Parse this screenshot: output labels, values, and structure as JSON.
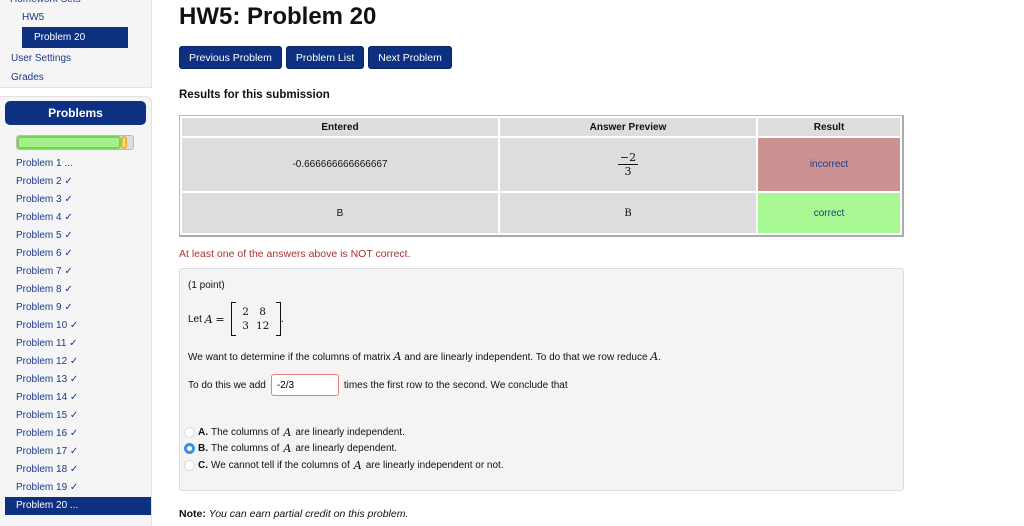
{
  "sidebar": {
    "truncated_top": "Homework Sets",
    "hw_link": "HW5",
    "current_problem": "Problem 20",
    "user_settings": "User Settings",
    "grades": "Grades"
  },
  "problems_panel": {
    "title": "Problems",
    "progress": {
      "correct_fraction": 0.9,
      "partial_fraction": 0.05,
      "green": "#a5f08a",
      "yellow": "#ffe94a"
    },
    "items": [
      {
        "label": "Problem 1 ...",
        "active": false
      },
      {
        "label": "Problem 2 ✓",
        "active": false
      },
      {
        "label": "Problem 3 ✓",
        "active": false
      },
      {
        "label": "Problem 4 ✓",
        "active": false
      },
      {
        "label": "Problem 5 ✓",
        "active": false
      },
      {
        "label": "Problem 6 ✓",
        "active": false
      },
      {
        "label": "Problem 7 ✓",
        "active": false
      },
      {
        "label": "Problem 8 ✓",
        "active": false
      },
      {
        "label": "Problem 9 ✓",
        "active": false
      },
      {
        "label": "Problem 10 ✓",
        "active": false
      },
      {
        "label": "Problem 11 ✓",
        "active": false
      },
      {
        "label": "Problem 12 ✓",
        "active": false
      },
      {
        "label": "Problem 13 ✓",
        "active": false
      },
      {
        "label": "Problem 14 ✓",
        "active": false
      },
      {
        "label": "Problem 15 ✓",
        "active": false
      },
      {
        "label": "Problem 16 ✓",
        "active": false
      },
      {
        "label": "Problem 17 ✓",
        "active": false
      },
      {
        "label": "Problem 18 ✓",
        "active": false
      },
      {
        "label": "Problem 19 ✓",
        "active": false
      },
      {
        "label": "Problem 20 ...",
        "active": true
      }
    ]
  },
  "main": {
    "title": "HW5: Problem 20",
    "buttons": {
      "previous": "Previous Problem",
      "list": "Problem List",
      "next": "Next Problem"
    },
    "results_title": "Results for this submission",
    "results_table": {
      "headers": [
        "Entered",
        "Answer Preview",
        "Result"
      ],
      "rows": [
        {
          "entered": "-0.666666666666667",
          "preview_num": "−2",
          "preview_den": "3",
          "result": "incorrect"
        },
        {
          "entered": "B",
          "preview": "B",
          "result": "correct"
        }
      ]
    },
    "warning": "At least one of the answers above is NOT correct.",
    "problem": {
      "points": "(1 point)",
      "let_a": "Let",
      "var": "A",
      "equals": "=",
      "matrix": [
        [
          "2",
          "8"
        ],
        [
          "3",
          "12"
        ]
      ],
      "line1_pre": "We want to determine if the columns of matrix",
      "line1_mid": "and are linearly independent. To do that we row reduce",
      "line2_pre": "To do this we add",
      "answer_value": "-2/3",
      "line2_post": "times the first row to the second. We conclude that",
      "options": [
        {
          "letter": "A.",
          "pre": "The columns of",
          "post": "are linearly independent.",
          "selected": false
        },
        {
          "letter": "B.",
          "pre": "The columns of",
          "post": "are linearly dependent.",
          "selected": true
        },
        {
          "letter": "C.",
          "pre": "We cannot tell if the columns of",
          "post": "are linearly independent or not.",
          "selected": false
        }
      ]
    },
    "note_label": "Note:",
    "note_text": "You can earn partial credit on this problem."
  }
}
